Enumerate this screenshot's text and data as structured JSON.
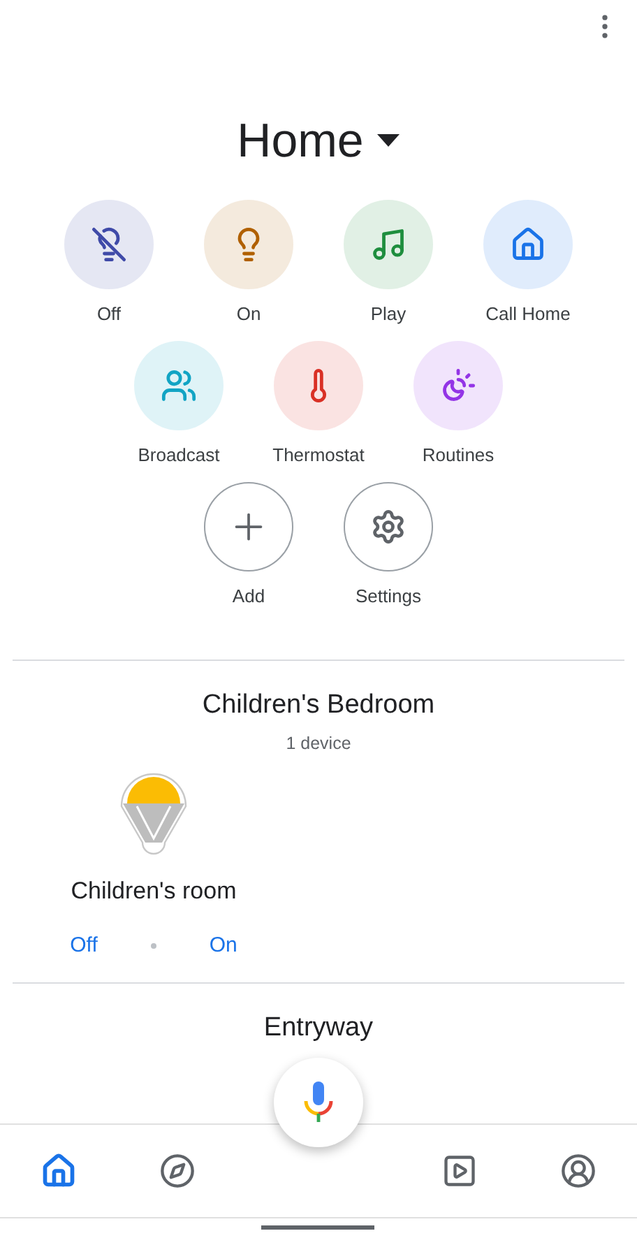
{
  "header": {
    "title": "Home"
  },
  "action_rows": [
    [
      {
        "label": "Off",
        "kind": "tinted",
        "color": "#3f4aa8"
      },
      {
        "label": "On",
        "kind": "tinted",
        "color": "#b06000"
      },
      {
        "label": "Play",
        "kind": "tinted",
        "color": "#1e8e3e"
      },
      {
        "label": "Call Home",
        "kind": "tinted",
        "color": "#1a73e8"
      }
    ],
    [
      {
        "label": "Broadcast",
        "kind": "tinted",
        "color": "#12a4c4"
      },
      {
        "label": "Thermostat",
        "kind": "tinted",
        "color": "#d93025"
      },
      {
        "label": "Routines",
        "kind": "tinted",
        "color": "#9334e6"
      }
    ],
    [
      {
        "label": "Add",
        "kind": "outlined"
      },
      {
        "label": "Settings",
        "kind": "outlined"
      }
    ]
  ],
  "rooms": [
    {
      "title": "Children's Bedroom",
      "subtitle": "1 device",
      "devices": [
        {
          "name": "Children's room",
          "off_label": "Off",
          "on_label": "On"
        }
      ]
    },
    {
      "title": "Entryway"
    }
  ],
  "bottom_nav": [
    {
      "selected": true
    },
    {
      "selected": false
    },
    {
      "selected": false
    },
    {
      "selected": false
    }
  ]
}
